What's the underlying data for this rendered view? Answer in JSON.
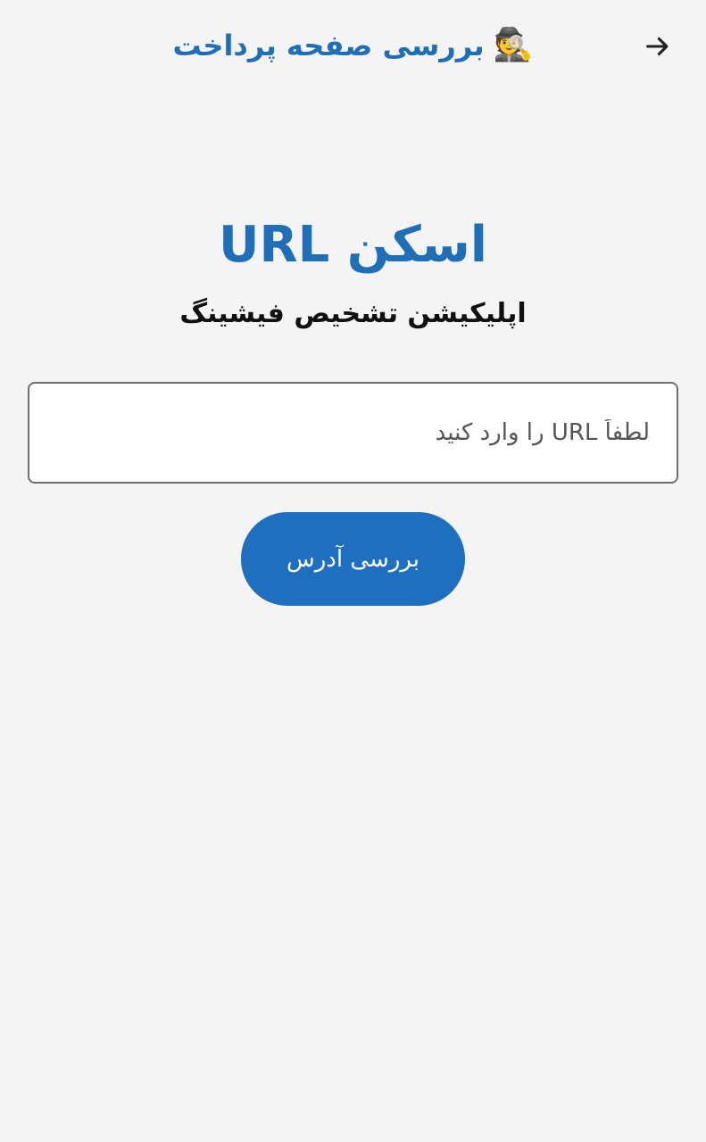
{
  "appbar": {
    "title": "بررسی صفحه پرداخت",
    "title_icon_emoji": "🕵️",
    "back_icon": "arrow-right-icon"
  },
  "main": {
    "heading": "اسکن URL",
    "subtitle": "اپلیکیشن تشخیص فیشینگ",
    "url_input": {
      "value": "",
      "placeholder": "لطفاً URL را وارد کنید"
    },
    "submit_label": "بررسی آدرس"
  },
  "colors": {
    "background": "#f4f4f4",
    "accent": "#1f6fb8",
    "button": "#1f6fc0",
    "text_dark": "#111111"
  }
}
